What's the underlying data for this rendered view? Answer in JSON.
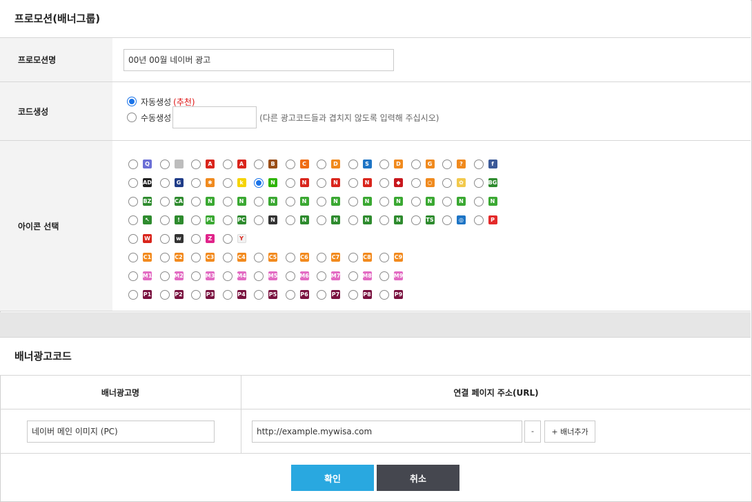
{
  "promotion": {
    "title": "프로모션(배너그룹)",
    "name_label": "프로모션명",
    "name_value": "00년 00월 네이버 광고",
    "code_label": "코드생성",
    "code_auto_label": "자동생성",
    "code_auto_note": "(추천)",
    "code_manual_label": "수동생성",
    "code_manual_hint": "(다른 광고코드들과 겹치지 않도록 입력해 주십시오)",
    "icon_label": "아이콘 선택"
  },
  "icons": [
    [
      {
        "name": "q-icon",
        "glyph": "Q",
        "bg": "#6b6fd6"
      },
      {
        "name": "apple-icon",
        "glyph": "",
        "bg": "#bdbdbd"
      },
      {
        "name": "a-red-icon",
        "glyph": "A",
        "bg": "#d9251c"
      },
      {
        "name": "a-red2-icon",
        "glyph": "A",
        "bg": "#d9251c"
      },
      {
        "name": "b-brown-icon",
        "glyph": "B",
        "bg": "#9a4d16"
      },
      {
        "name": "c-orange-icon",
        "glyph": "C",
        "bg": "#ef6c12"
      },
      {
        "name": "d-orange-icon",
        "glyph": "D",
        "bg": "#f08a1e"
      },
      {
        "name": "s-icon",
        "glyph": "S",
        "bg": "#1d74c5"
      },
      {
        "name": "d-orange2-icon",
        "glyph": "D",
        "bg": "#f08a1e"
      },
      {
        "name": "g-orange-icon",
        "glyph": "G",
        "bg": "#f08a1e"
      },
      {
        "name": "question-icon",
        "glyph": "?",
        "bg": "#f08a1e"
      },
      {
        "name": "facebook-icon",
        "glyph": "f",
        "bg": "#3b5998"
      }
    ],
    [
      {
        "name": "ad-icon",
        "glyph": "AD",
        "bg": "#222222"
      },
      {
        "name": "g-navy-icon",
        "glyph": "G",
        "bg": "#1f3c88"
      },
      {
        "name": "puzzle-icon",
        "glyph": "✱",
        "bg": "#f08a1e"
      },
      {
        "name": "k-icon",
        "glyph": "k",
        "bg": "#f5d300"
      },
      {
        "name": "n-green-icon",
        "glyph": "N",
        "bg": "#2db400"
      },
      {
        "name": "n-red-icon",
        "glyph": "N",
        "bg": "#d9251c"
      },
      {
        "name": "n2-red-icon",
        "glyph": "N",
        "bg": "#d9251c"
      },
      {
        "name": "n3-red-icon",
        "glyph": "N",
        "bg": "#d9251c"
      },
      {
        "name": "ruby-icon",
        "glyph": "◆",
        "bg": "#c8171d"
      },
      {
        "name": "ring-icon",
        "glyph": "○",
        "bg": "#f08a1e"
      },
      {
        "name": "flower-icon",
        "glyph": "✿",
        "bg": "#f2c94c"
      },
      {
        "name": "bg-icon",
        "glyph": "BG",
        "bg": "#2e8b2e"
      }
    ],
    [
      {
        "name": "bz-icon",
        "glyph": "BZ",
        "bg": "#2e8b2e"
      },
      {
        "name": "ca-icon",
        "glyph": "CA",
        "bg": "#2e8b2e"
      },
      {
        "name": "n-green2-icon",
        "glyph": "N",
        "bg": "#3aa832"
      },
      {
        "name": "n1-icon",
        "glyph": "N",
        "bg": "#3aa832"
      },
      {
        "name": "n2-icon",
        "glyph": "N",
        "bg": "#3aa832"
      },
      {
        "name": "n3-icon",
        "glyph": "N",
        "bg": "#3aa832"
      },
      {
        "name": "n4-icon",
        "glyph": "N",
        "bg": "#3aa832"
      },
      {
        "name": "n5-icon",
        "glyph": "N",
        "bg": "#3aa832"
      },
      {
        "name": "n6-icon",
        "glyph": "N",
        "bg": "#3aa832"
      },
      {
        "name": "n7-icon",
        "glyph": "N",
        "bg": "#3aa832"
      },
      {
        "name": "n8-icon",
        "glyph": "N",
        "bg": "#3aa832"
      },
      {
        "name": "n9-icon",
        "glyph": "N",
        "bg": "#3aa832"
      }
    ],
    [
      {
        "name": "arrow-green-icon",
        "glyph": "↖",
        "bg": "#2e8b2e"
      },
      {
        "name": "exclaim-green-icon",
        "glyph": "!",
        "bg": "#2e8b2e"
      },
      {
        "name": "pl-icon",
        "glyph": "PL",
        "bg": "#3aa832"
      },
      {
        "name": "pc-icon",
        "glyph": "PC",
        "bg": "#2e8b2e"
      },
      {
        "name": "n-black-icon",
        "glyph": "N",
        "bg": "#333333"
      },
      {
        "name": "n-green3-icon",
        "glyph": "N",
        "bg": "#2e8b2e"
      },
      {
        "name": "na-icon",
        "glyph": "N",
        "bg": "#2e8b2e"
      },
      {
        "name": "nb-icon",
        "glyph": "N",
        "bg": "#2e8b2e"
      },
      {
        "name": "nc-icon",
        "glyph": "N",
        "bg": "#2e8b2e"
      },
      {
        "name": "ts-icon",
        "glyph": "TS",
        "bg": "#2e8b2e"
      },
      {
        "name": "target-icon",
        "glyph": "◎",
        "bg": "#1d74c5"
      },
      {
        "name": "p-red-icon",
        "glyph": "P",
        "bg": "#e32a2a"
      }
    ],
    [
      {
        "name": "w-icon",
        "glyph": "W",
        "bg": "#d9251c"
      },
      {
        "name": "w-black-icon",
        "glyph": "w",
        "bg": "#333333"
      },
      {
        "name": "z-pink-icon",
        "glyph": "Z",
        "bg": "#e0248a"
      },
      {
        "name": "y-icon",
        "glyph": "Y",
        "bg": "#f1f1f1"
      }
    ],
    [
      {
        "name": "c1-icon",
        "glyph": "C1",
        "bg": "#f28a1e"
      },
      {
        "name": "c2-icon",
        "glyph": "C2",
        "bg": "#f28a1e"
      },
      {
        "name": "c3-icon",
        "glyph": "C3",
        "bg": "#f28a1e"
      },
      {
        "name": "c4-icon",
        "glyph": "C4",
        "bg": "#f28a1e"
      },
      {
        "name": "c5-icon",
        "glyph": "C5",
        "bg": "#f28a1e"
      },
      {
        "name": "c6-icon",
        "glyph": "C6",
        "bg": "#f28a1e"
      },
      {
        "name": "c7-icon",
        "glyph": "C7",
        "bg": "#f28a1e"
      },
      {
        "name": "c8-icon",
        "glyph": "C8",
        "bg": "#f28a1e"
      },
      {
        "name": "c9-icon",
        "glyph": "C9",
        "bg": "#f28a1e"
      }
    ],
    [
      {
        "name": "m1-icon",
        "glyph": "M1",
        "bg": "#e36cc3"
      },
      {
        "name": "m2-icon",
        "glyph": "M2",
        "bg": "#e36cc3"
      },
      {
        "name": "m3-icon",
        "glyph": "M3",
        "bg": "#e36cc3"
      },
      {
        "name": "m4-icon",
        "glyph": "M4",
        "bg": "#e36cc3"
      },
      {
        "name": "m5-icon",
        "glyph": "M5",
        "bg": "#e36cc3"
      },
      {
        "name": "m6-icon",
        "glyph": "M6",
        "bg": "#e36cc3"
      },
      {
        "name": "m7-icon",
        "glyph": "M7",
        "bg": "#e36cc3"
      },
      {
        "name": "m8-icon",
        "glyph": "M8",
        "bg": "#e36cc3"
      },
      {
        "name": "m9-icon",
        "glyph": "M9",
        "bg": "#e36cc3"
      }
    ],
    [
      {
        "name": "p1-icon",
        "glyph": "P1",
        "bg": "#7a1240"
      },
      {
        "name": "p2-icon",
        "glyph": "P2",
        "bg": "#7a1240"
      },
      {
        "name": "p3-icon",
        "glyph": "P3",
        "bg": "#7a1240"
      },
      {
        "name": "p4-icon",
        "glyph": "P4",
        "bg": "#7a1240"
      },
      {
        "name": "p5-icon",
        "glyph": "P5",
        "bg": "#7a1240"
      },
      {
        "name": "p6-icon",
        "glyph": "P6",
        "bg": "#7a1240"
      },
      {
        "name": "p7-icon",
        "glyph": "P7",
        "bg": "#7a1240"
      },
      {
        "name": "p8-icon",
        "glyph": "P8",
        "bg": "#7a1240"
      },
      {
        "name": "p9-icon",
        "glyph": "P9",
        "bg": "#7a1240"
      }
    ]
  ],
  "selected_icon": "n-green-icon",
  "banner": {
    "title": "배너광고코드",
    "col_name": "배너광고명",
    "col_url": "연결 페이지 주소(URL)",
    "name_value": "네이버 메인 이미지 (PC)",
    "url_value": "http://example.mywisa.com",
    "remove_label": "-",
    "add_label": "+ 배너추가"
  },
  "actions": {
    "confirm": "확인",
    "cancel": "취소"
  },
  "colors": {
    "primary": "#29a8e0",
    "dark": "#45474f",
    "radio_checked": "#1a73e8"
  }
}
